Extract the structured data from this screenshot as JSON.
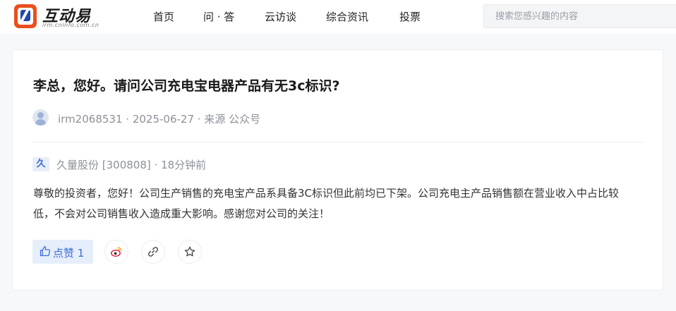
{
  "header": {
    "logo_text": "互动易",
    "logo_subtext": "irm.cninfo.com.cn",
    "nav": [
      "首页",
      "问 · 答",
      "云访谈",
      "综合资讯",
      "投票"
    ],
    "search_placeholder": "搜索您感兴趣的内容"
  },
  "question": {
    "title": "李总，您好。请问公司充电宝电器产品有无3c标识?",
    "user": "irm2068531",
    "date": "2025-06-27",
    "source": "来源 公众号"
  },
  "answer": {
    "company_badge": "久",
    "company": "久量股份 [300808]",
    "time": "18分钟前",
    "text": "尊敬的投资者，您好！公司生产销售的充电宝产品系具备3C标识但此前均已下架。公司充电主产品销售额在营业收入中占比较低，不会对公司销售收入造成重大影响。感谢您对公司的关注！"
  },
  "actions": {
    "like_label": "点赞",
    "like_count": "1"
  },
  "colors": {
    "accent": "#3d6fd6",
    "logo_orange": "#e8501d",
    "logo_blue": "#1f4aa8"
  },
  "icons": [
    "thumbs-up-icon",
    "weibo-icon",
    "link-icon",
    "star-icon",
    "user-avatar-icon"
  ]
}
